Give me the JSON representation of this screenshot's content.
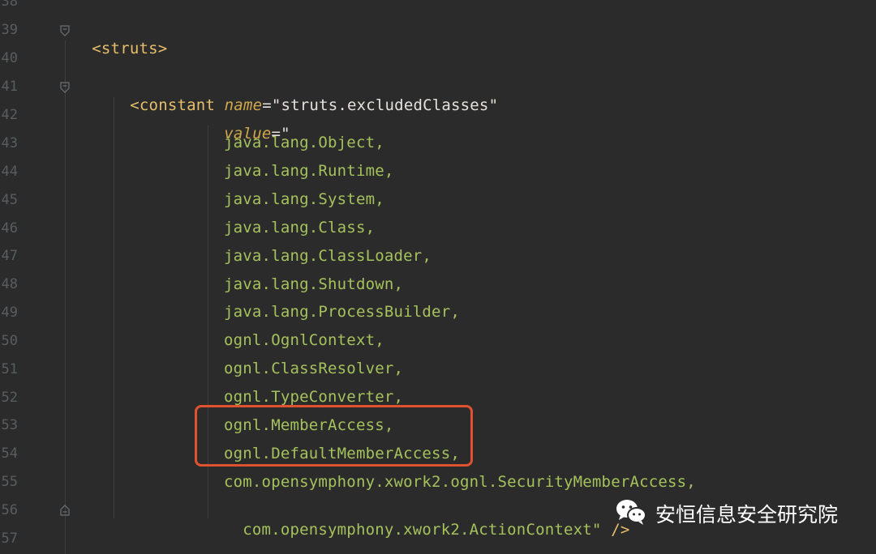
{
  "editor": {
    "line_numbers": [
      "38",
      "39",
      "40",
      "41",
      "42",
      "43",
      "44",
      "45",
      "46",
      "47",
      "48",
      "49",
      "50",
      "51",
      "52",
      "53",
      "54",
      "55",
      "56",
      "57"
    ],
    "lines": {
      "l39_tag": "<struts>",
      "l41_open": "<constant ",
      "l41_attr": "name",
      "l41_eq": "=",
      "l41_val": "\"struts.excludedClasses\"",
      "l42_attr": "value",
      "l42_eq": "=",
      "l42_val": "\"",
      "l43": "java.lang.Object,",
      "l44": "java.lang.Runtime,",
      "l45": "java.lang.System,",
      "l46": "java.lang.Class,",
      "l47": "java.lang.ClassLoader,",
      "l48": "java.lang.Shutdown,",
      "l49": "java.lang.ProcessBuilder,",
      "l50": "ognl.OgnlContext,",
      "l51": "ognl.ClassResolver,",
      "l52": "ognl.TypeConverter,",
      "l53": "ognl.MemberAccess,",
      "l54": "ognl.DefaultMemberAccess,",
      "l55": "com.opensymphony.xwork2.ognl.SecurityMemberAccess,",
      "l56_val": "com.opensymphony.xwork2.ActionContext\"",
      "l56_close": " />"
    }
  },
  "watermark": {
    "text": "安恒信息安全研究院",
    "icon": "wechat-icon"
  },
  "colors": {
    "background": "#2b2b2b",
    "tag": "#e8bf6a",
    "attribute": "#d0a84a",
    "string": "#a5c25c",
    "highlight": "#e0522f"
  }
}
